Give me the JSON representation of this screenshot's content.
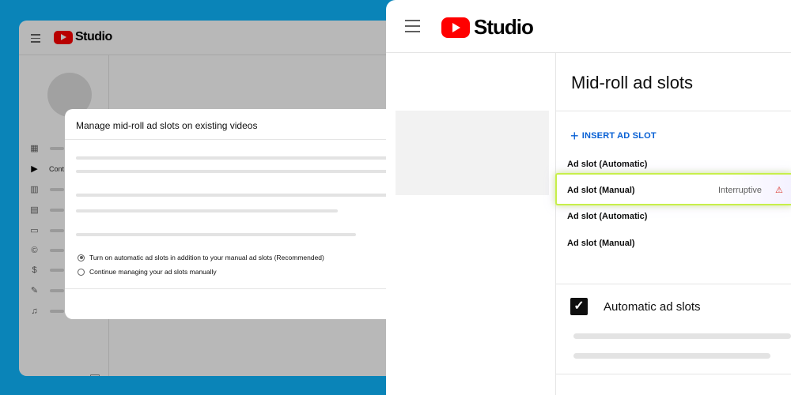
{
  "back_window": {
    "app_title": "Studio",
    "sidebar": {
      "items": [
        {
          "icon": "dashboard-icon",
          "label": ""
        },
        {
          "icon": "content-icon",
          "label": "Cont"
        },
        {
          "icon": "analytics-icon",
          "label": ""
        },
        {
          "icon": "comments-icon",
          "label": ""
        },
        {
          "icon": "subtitles-icon",
          "label": ""
        },
        {
          "icon": "copyright-icon",
          "label": ""
        },
        {
          "icon": "earn-icon",
          "label": ""
        },
        {
          "icon": "customization-icon",
          "label": ""
        },
        {
          "icon": "audio-library-icon",
          "label": ""
        }
      ]
    },
    "dialog": {
      "title": "Manage mid-roll ad slots on existing videos",
      "options": [
        {
          "label": "Turn on automatic ad slots in addition to your manual ad slots (Recommended)",
          "selected": true
        },
        {
          "label": "Continue managing your ad slots manually",
          "selected": false
        }
      ]
    }
  },
  "front_window": {
    "app_title": "Studio",
    "page_title": "Mid-roll ad slots",
    "insert_button": "INSERT AD SLOT",
    "slots": [
      {
        "label": "Ad slot (Automatic)",
        "status": "",
        "highlighted": false
      },
      {
        "label": "Ad slot (Manual)",
        "status": "Interruptive",
        "highlighted": true
      },
      {
        "label": "Ad slot (Automatic)",
        "status": "",
        "highlighted": false
      },
      {
        "label": "Ad slot (Manual)",
        "status": "",
        "highlighted": false
      }
    ],
    "automatic_ad_slots": {
      "label": "Automatic ad slots",
      "checked": true
    }
  },
  "colors": {
    "background": "#0a84b8",
    "youtube_red": "#ff0000",
    "link_blue": "#065fd4",
    "highlight_border": "#c7ef4a",
    "warning_red": "#d93025"
  }
}
